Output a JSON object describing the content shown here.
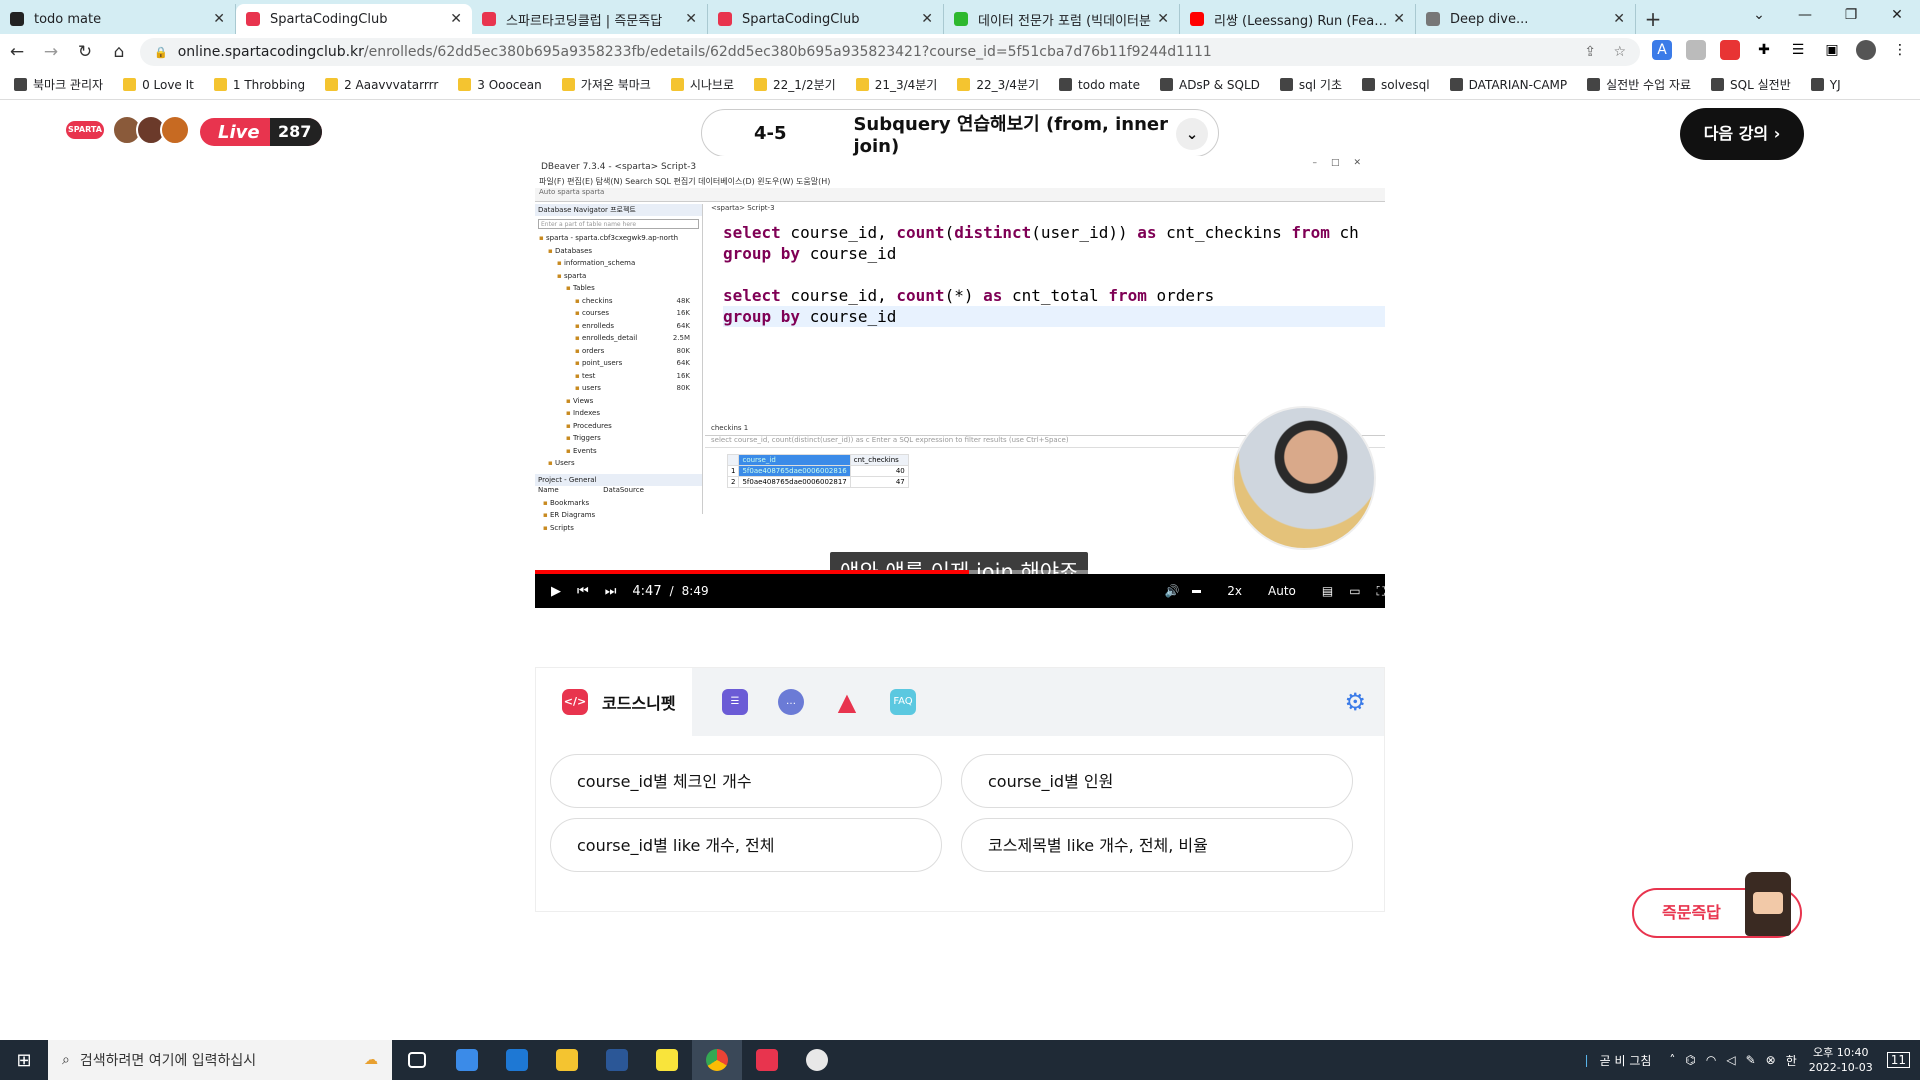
{
  "browser": {
    "tabs": [
      {
        "title": "todo mate",
        "color": "#222222"
      },
      {
        "title": "SpartaCodingClub",
        "color": "#e8344e",
        "active": true
      },
      {
        "title": "스파르타코딩클럽 | 즉문즉답",
        "color": "#e8344e"
      },
      {
        "title": "SpartaCodingClub",
        "color": "#e8344e"
      },
      {
        "title": "데이터 전문가 포럼 (빅데이터분",
        "color": "#2eb82e"
      },
      {
        "title": "리쌍 (Leessang) Run (Feat YB)",
        "color": "#ff0000"
      },
      {
        "title": "Deep dive...",
        "color": "#777777"
      }
    ],
    "url_host": "online.spartacodingclub.kr",
    "url_path": "/enrolleds/62dd5ec380b695a9358233fb/edetails/62dd5ec380b695a935823421?course_id=5f51cba7d76b11f9244d1111",
    "bookmarks": [
      "북마크 관리자",
      "0 Love It",
      "1 Throbbing",
      "2 Aaavvvatarrrr",
      "3 Ooocean",
      "가져온 북마크",
      "시나브로",
      "22_1/2분기",
      "21_3/4분기",
      "22_3/4분기",
      "todo mate",
      "ADsP & SQLD",
      "sql 기초",
      "solvesql",
      "DATARIAN-CAMP",
      "실전반 수업 자료",
      "SQL 실전반",
      "YJ"
    ]
  },
  "header": {
    "logo_text": "SPARTA",
    "live_label": "Live",
    "live_count": "287",
    "lecture_number": "4-5",
    "lecture_title": "Subquery 연습해보기 (from, inner join)",
    "next_button": "다음 강의"
  },
  "video": {
    "dbeaver_title": "DBeaver 7.3.4 - <sparta> Script-3",
    "menu": "파일(F) 편집(E) 탐색(N) Search SQL 편집기 데이터베이스(D) 윈도우(W) 도움말(H)",
    "toolbar": "Auto  sparta  sparta",
    "nav_header": "Database Navigator  프로젝트",
    "nav_filter": "Enter a part of table name here",
    "tree": [
      {
        "label": "sparta - sparta.cbf3cxegwk9.ap-north",
        "indent": 0
      },
      {
        "label": "Databases",
        "indent": 1
      },
      {
        "label": "information_schema",
        "indent": 2
      },
      {
        "label": "sparta",
        "indent": 2
      },
      {
        "label": "Tables",
        "indent": 3
      },
      {
        "label": "checkins",
        "indent": 4,
        "size": "48K"
      },
      {
        "label": "courses",
        "indent": 4,
        "size": "16K"
      },
      {
        "label": "enrolleds",
        "indent": 4,
        "size": "64K"
      },
      {
        "label": "enrolleds_detail",
        "indent": 4,
        "size": "2.5M"
      },
      {
        "label": "orders",
        "indent": 4,
        "size": "80K"
      },
      {
        "label": "point_users",
        "indent": 4,
        "size": "64K"
      },
      {
        "label": "test",
        "indent": 4,
        "size": "16K"
      },
      {
        "label": "users",
        "indent": 4,
        "size": "80K"
      },
      {
        "label": "Views",
        "indent": 3
      },
      {
        "label": "Indexes",
        "indent": 3
      },
      {
        "label": "Procedures",
        "indent": 3
      },
      {
        "label": "Triggers",
        "indent": 3
      },
      {
        "label": "Events",
        "indent": 3
      },
      {
        "label": "Users",
        "indent": 1
      }
    ],
    "project_header": "Project - General",
    "project_cols": "Name                    DataSource",
    "project_items": [
      "Bookmarks",
      "ER Diagrams",
      "Scripts"
    ],
    "editor_tab": "<sparta> Script-3",
    "code_lines": [
      [
        "select",
        " course_id, ",
        "count",
        "(",
        "distinct",
        "(user_id)) ",
        "as",
        " cnt_checkins ",
        "from",
        " ch"
      ],
      [
        "group by",
        " course_id"
      ],
      [
        ""
      ],
      [
        "select",
        " course_id, ",
        "count",
        "(*) ",
        "as",
        " cnt_total ",
        "from",
        " orders"
      ],
      [
        "group by",
        " course_id "
      ]
    ],
    "results_tab": "checkins 1",
    "results_filter": "select course_id, count(distinct(user_id)) as c  Enter a SQL expression to filter results (use Ctrl+Space)",
    "results_cols": [
      "course_id",
      "cnt_checkins"
    ],
    "results_rows": [
      {
        "n": "1",
        "course_id": "5f0ae408765dae0006002816",
        "cnt": "40"
      },
      {
        "n": "2",
        "course_id": "5f0ae408765dae0006002817",
        "cnt": "47"
      }
    ],
    "subtitle": "얘와 얘를 이제 join 해야죠",
    "current_time": "4:47",
    "separator": "/",
    "duration": "8:49",
    "progress": 0.51,
    "speed": "2x",
    "quality": "Auto"
  },
  "snippets": {
    "tab_label": "코드스니펫",
    "faq_label": "FAQ",
    "items": [
      "course_id별 체크인 개수",
      "course_id별 인원",
      "course_id별 like 개수, 전체",
      "코스제목별 like 개수, 전체, 비율"
    ]
  },
  "qa_button": "즉문즉답",
  "taskbar": {
    "search_placeholder": "검색하려면 여기에 입력하십시",
    "weather": "곧 비 그침",
    "time_top": "오후 10:40",
    "time_bottom": "2022-10-03",
    "notif": "11"
  }
}
